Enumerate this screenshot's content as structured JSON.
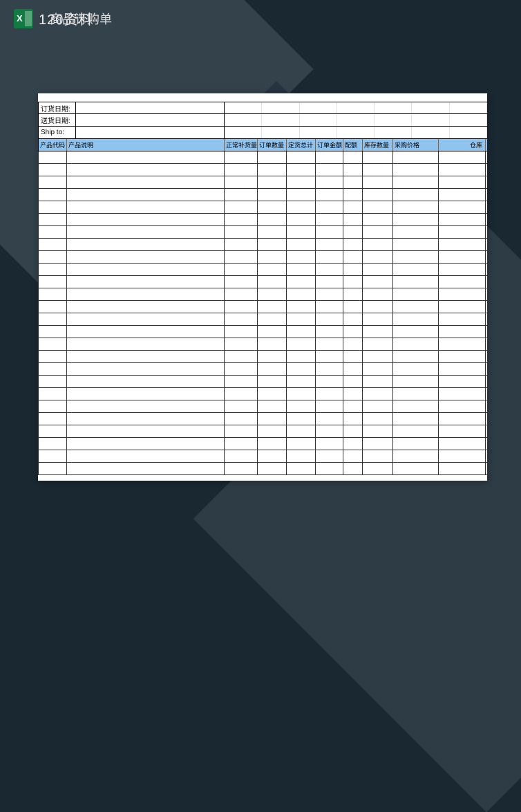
{
  "watermark": "120资料",
  "title": "商品订购单",
  "info": {
    "order_date_label": "订货日期:",
    "order_date_value": "",
    "delivery_date_label": "送货日期:",
    "delivery_date_value": "",
    "ship_to_label": "Ship to:",
    "ship_to_value": ""
  },
  "columns": {
    "product_code": "产品代码",
    "product_desc": "产品说明",
    "normal_restock": "正常补货量",
    "order_qty": "订单数量",
    "order_total": "定货总计",
    "order_amount": "订单金额",
    "allocation": "配额",
    "stock_qty": "库存数量",
    "purchase_price": "采购价格",
    "warehouse": "仓库"
  },
  "row_count": 26,
  "excel_icon_letter": "X"
}
